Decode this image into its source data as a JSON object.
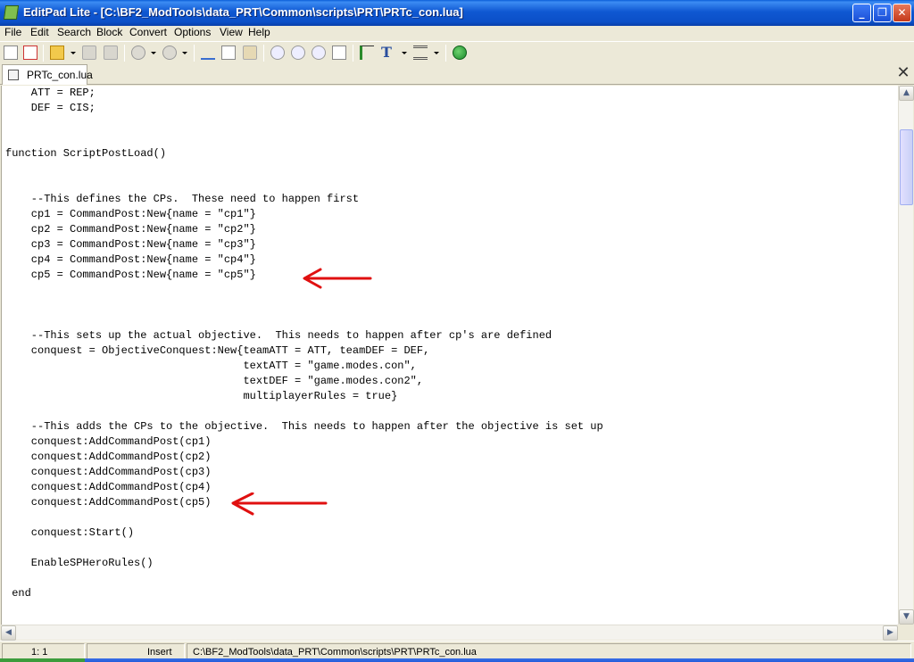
{
  "window": {
    "title": "EditPad Lite - [C:\\BF2_ModTools\\data_PRT\\Common\\scripts\\PRT\\PRTc_con.lua]",
    "minimize_glyph": "_",
    "maximize_glyph": "❐",
    "close_glyph": "✕"
  },
  "menu": [
    "File",
    "Edit",
    "Search",
    "Block",
    "Convert",
    "Options",
    "View",
    "Help"
  ],
  "tab": {
    "label": "PRTc_con.lua",
    "close_glyph": "✕"
  },
  "code_lines": [
    "    ATT = REP;",
    "    DEF = CIS;",
    "",
    "",
    "function ScriptPostLoad()",
    "",
    "",
    "    --This defines the CPs.  These need to happen first",
    "    cp1 = CommandPost:New{name = \"cp1\"}",
    "    cp2 = CommandPost:New{name = \"cp2\"}",
    "    cp3 = CommandPost:New{name = \"cp3\"}",
    "    cp4 = CommandPost:New{name = \"cp4\"}",
    "    cp5 = CommandPost:New{name = \"cp5\"}",
    "",
    "",
    "",
    "    --This sets up the actual objective.  This needs to happen after cp's are defined",
    "    conquest = ObjectiveConquest:New{teamATT = ATT, teamDEF = DEF,",
    "                                     textATT = \"game.modes.con\",",
    "                                     textDEF = \"game.modes.con2\",",
    "                                     multiplayerRules = true}",
    "",
    "    --This adds the CPs to the objective.  This needs to happen after the objective is set up",
    "    conquest:AddCommandPost(cp1)",
    "    conquest:AddCommandPost(cp2)",
    "    conquest:AddCommandPost(cp3)",
    "    conquest:AddCommandPost(cp4)",
    "    conquest:AddCommandPost(cp5)",
    "",
    "    conquest:Start()",
    "",
    "    EnableSPHeroRules()",
    "",
    " end"
  ],
  "annotation_color": "#E01010",
  "status": {
    "position": "1: 1",
    "mode": "Insert",
    "path": "C:\\BF2_ModTools\\data_PRT\\Common\\scripts\\PRT\\PRTc_con.lua"
  },
  "icons": {
    "toolbar": [
      "new-file-icon",
      "close-file-icon",
      "open-folder-icon",
      "save-icon",
      "save-all-icon",
      "undo-icon",
      "redo-icon",
      "cut-icon",
      "copy-icon",
      "paste-icon",
      "find-icon",
      "find-next-icon",
      "find-previous-icon",
      "replace-icon",
      "indent-icon",
      "font-icon",
      "block-format-icon",
      "go-web-icon"
    ]
  }
}
